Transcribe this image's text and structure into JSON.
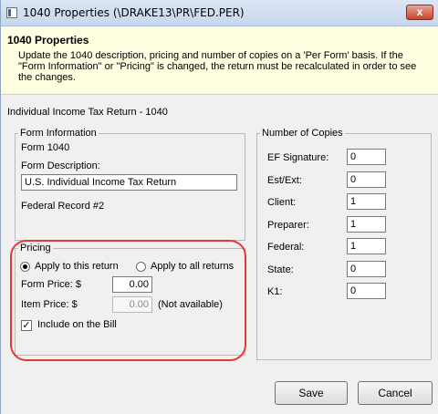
{
  "window": {
    "title": "1040 Properties (\\DRAKE13\\PR\\FED.PER)",
    "close_glyph": "x"
  },
  "header": {
    "title": "1040 Properties",
    "description": "Update the 1040 description, pricing and number of copies on a 'Per Form' basis. If the \"Form Information\" or \"Pricing\" is changed, the return must be recalculated in order to see the changes."
  },
  "form_type": "Individual Income Tax Return - 1040",
  "form_information": {
    "legend": "Form Information",
    "form_name": "Form 1040",
    "description_label": "Form Description:",
    "description_value": "U.S. Individual Income Tax Return",
    "record": "Federal Record #2"
  },
  "pricing": {
    "legend": "Pricing",
    "apply_this_label": "Apply to this return",
    "apply_all_label": "Apply to all returns",
    "selected": "Apply to this return",
    "form_price_label": "Form Price: $",
    "form_price_value": "0.00",
    "item_price_label": "Item Price: $",
    "item_price_value": "0.00",
    "item_price_note": "(Not available)",
    "include_label": "Include on the Bill",
    "include_checked": true
  },
  "copies": {
    "legend": "Number of Copies",
    "rows": [
      {
        "label": "EF Signature:",
        "value": "0"
      },
      {
        "label": "Est/Ext:",
        "value": "0"
      },
      {
        "label": "Client:",
        "value": "1"
      },
      {
        "label": "Preparer:",
        "value": "1"
      },
      {
        "label": "Federal:",
        "value": "1"
      },
      {
        "label": "State:",
        "value": "0"
      },
      {
        "label": "K1:",
        "value": "0"
      }
    ]
  },
  "buttons": {
    "save": "Save",
    "cancel": "Cancel"
  },
  "colors": {
    "header_bg": "#fefee0",
    "highlight": "#e23a3a",
    "window_bg": "#f0f0f0"
  }
}
